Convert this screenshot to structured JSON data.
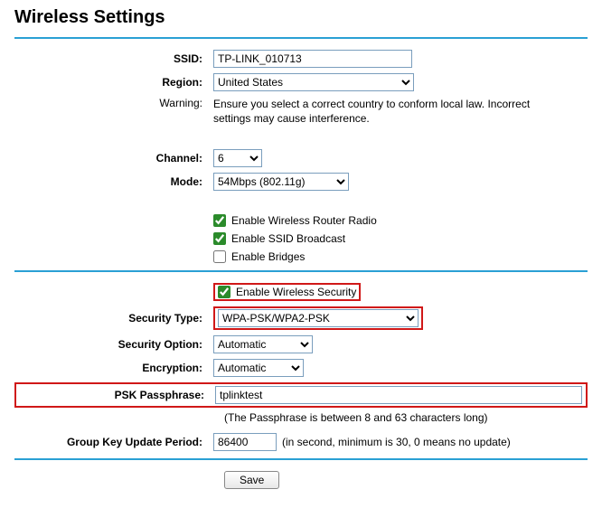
{
  "title": "Wireless Settings",
  "labels": {
    "ssid": "SSID:",
    "region": "Region:",
    "warning": "Warning:",
    "channel": "Channel:",
    "mode": "Mode:",
    "securityType": "Security Type:",
    "securityOption": "Security Option:",
    "encryption": "Encryption:",
    "pskPassphrase": "PSK Passphrase:",
    "groupKeyUpdatePeriod": "Group Key Update Period:"
  },
  "values": {
    "ssid": "TP-LINK_010713",
    "region": "United States",
    "channel": "6",
    "mode": "54Mbps (802.11g)",
    "securityType": "WPA-PSK/WPA2-PSK",
    "securityOption": "Automatic",
    "encryption": "Automatic",
    "pskPassphrase": "tplinktest",
    "groupKeyUpdatePeriod": "86400"
  },
  "checkbox": {
    "enableRouterRadioLabel": "Enable Wireless Router Radio",
    "enableSSIDLabel": "Enable SSID Broadcast",
    "enableBridgesLabel": "Enable Bridges",
    "enableSecurityLabel": "Enable Wireless Security"
  },
  "helpText": {
    "warning": "Ensure you select a correct country to conform local law. Incorrect settings may cause interference.",
    "passphraseNote": "(The Passphrase is between 8 and 63 characters long)",
    "groupKeyNote": "(in second, minimum is 30, 0 means no update)"
  },
  "buttons": {
    "save": "Save"
  }
}
